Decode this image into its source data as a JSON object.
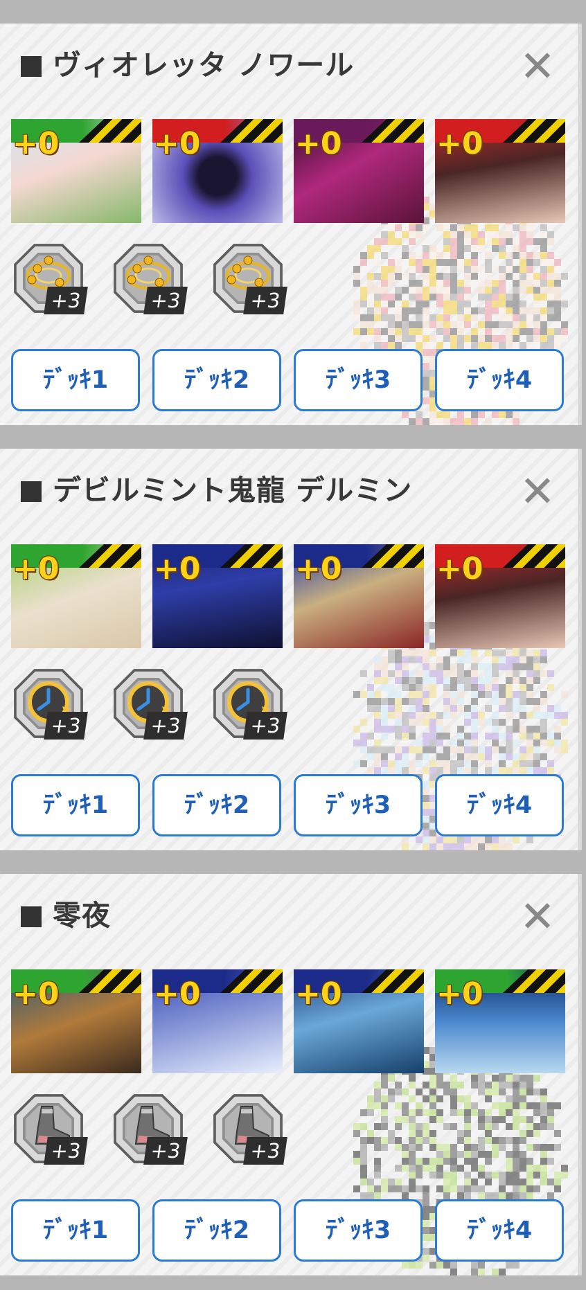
{
  "sections": [
    {
      "title": "ヴィオレッタ ノワール",
      "thumbs": [
        {
          "plus": "+0",
          "bg": "linear-gradient(160deg,#cfe8f5 0%,#f5d8d2 45%,#86b86a 100%)",
          "band": "#2fa531"
        },
        {
          "plus": "+0",
          "bg": "radial-gradient(circle at 50% 55%,#1a1530 0 22%,#5b4fb8 40%,#c9c8ee 100%)",
          "band": "#d21e1e"
        },
        {
          "plus": "+0",
          "bg": "linear-gradient(150deg,#3a0f2c 0%,#b0287d 45%,#5a1438 100%)",
          "band": "#6a1a5a"
        },
        {
          "plus": "+0",
          "bg": "linear-gradient(170deg,#c22929 0%,#4a2626 45%,#e6c6b4 100%)",
          "band": "#d21e1e"
        }
      ],
      "gems": [
        {
          "level": "+3",
          "icon": "orbit-gem-icon",
          "accent": "#e2b437"
        },
        {
          "level": "+3",
          "icon": "orbit-gem-icon",
          "accent": "#e2b437"
        },
        {
          "level": "+3",
          "icon": "orbit-gem-icon",
          "accent": "#e2b437"
        }
      ],
      "decks": [
        "ﾃﾞｯｷ1",
        "ﾃﾞｯｷ2",
        "ﾃﾞｯｷ3",
        "ﾃﾞｯｷ4"
      ]
    },
    {
      "title": "デビルミント鬼龍 デルミン",
      "thumbs": [
        {
          "plus": "+0",
          "bg": "linear-gradient(160deg,#a8cf6c 0%,#eae0cd 50%,#d9c8a8 100%)",
          "band": "#2fa531"
        },
        {
          "plus": "+0",
          "bg": "linear-gradient(170deg,#1b1d6b 0%,#2e3ea8 40%,#0f1030 100%)",
          "band": "#1c2a8a"
        },
        {
          "plus": "+0",
          "bg": "linear-gradient(160deg,#2038a8 0%,#c9b080 45%,#8a2626 100%)",
          "band": "#1c2a8a"
        },
        {
          "plus": "+0",
          "bg": "linear-gradient(170deg,#c22929 0%,#4a2626 45%,#e6c6b4 100%)",
          "band": "#d21e1e"
        }
      ],
      "gems": [
        {
          "level": "+3",
          "icon": "clock-gem-icon",
          "accent": "#3b8ee0"
        },
        {
          "level": "+3",
          "icon": "clock-gem-icon",
          "accent": "#3b8ee0"
        },
        {
          "level": "+3",
          "icon": "clock-gem-icon",
          "accent": "#3b8ee0"
        }
      ],
      "decks": [
        "ﾃﾞｯｷ1",
        "ﾃﾞｯｷ2",
        "ﾃﾞｯｷ3",
        "ﾃﾞｯｷ4"
      ]
    },
    {
      "title": "零夜",
      "thumbs": [
        {
          "plus": "+0",
          "bg": "linear-gradient(160deg,#2e5a7a 0%,#b07a3a 50%,#3a2a1e 100%)",
          "band": "#2fa531"
        },
        {
          "plus": "+0",
          "bg": "linear-gradient(165deg,#3548b5 0%,#8a9ad8 50%,#e8eefc 100%)",
          "band": "#1c2a8a"
        },
        {
          "plus": "+0",
          "bg": "linear-gradient(165deg,#1e3a78 0%,#6aa8d8 45%,#16406a 100%)",
          "band": "#1c2a8a"
        },
        {
          "plus": "+0",
          "bg": "linear-gradient(180deg,#0b2a66 0%,#4a88cf 50%,#b8d8ef 100%)",
          "band": "#2fa531"
        }
      ],
      "gems": [
        {
          "level": "+3",
          "icon": "boot-gem-icon",
          "accent": "#d98a8a"
        },
        {
          "level": "+3",
          "icon": "boot-gem-icon",
          "accent": "#d98a8a"
        },
        {
          "level": "+3",
          "icon": "boot-gem-icon",
          "accent": "#d98a8a"
        }
      ],
      "decks": [
        "ﾃﾞｯｷ1",
        "ﾃﾞｯｷ2",
        "ﾃﾞｯｷ3",
        "ﾃﾞｯｷ4"
      ]
    }
  ],
  "colors": {
    "deck_border": "#2a7bd6",
    "deck_text": "#1f5fb8",
    "title_text": "#383838",
    "close_icon": "#888888",
    "pixel_palettes": [
      [
        "#8c8c8c",
        "#b9b9b9",
        "#f3e2d5",
        "#fbf0e8",
        "#f0b0b6",
        "#f3d86a"
      ],
      [
        "#8c8c8c",
        "#b9b9b9",
        "#d8ecf6",
        "#c7b5e6",
        "#f3e6a0",
        "#f3e2d5"
      ],
      [
        "#7a7a7a",
        "#a6a6a6",
        "#cfeaa0",
        "#efefef",
        "#5a5a5a",
        "#bfe08a"
      ]
    ]
  }
}
